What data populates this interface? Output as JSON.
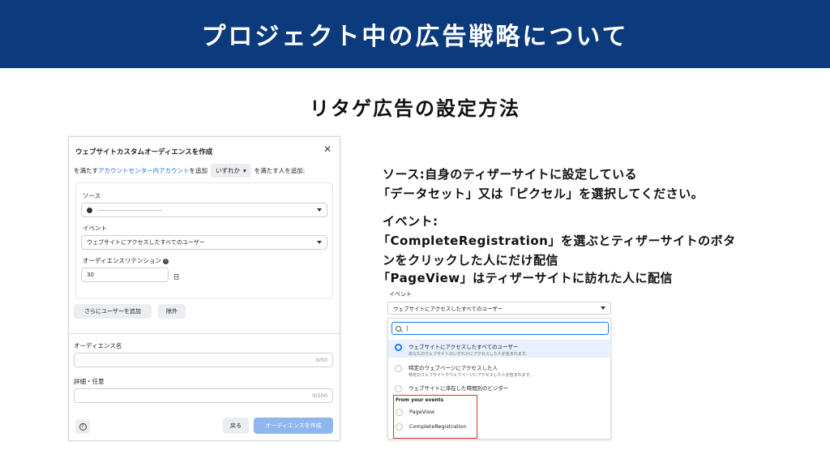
{
  "header": {
    "title": "プロジェクト中の広告戦略について"
  },
  "subtitle": "リタゲ広告の設定方法",
  "dialog": {
    "title": "ウェブサイトカスタムオーディエンスを作成",
    "criteria_prefix": "を満たす",
    "criteria_link": "アカウントセンター内アカウント",
    "criteria_mid": "を追加",
    "criteria_pill": "いずれか",
    "criteria_suffix": "を満たす人を追加:",
    "source_label": "ソース",
    "event_label": "イベント",
    "event_value": "ウェブサイトにアクセスしたすべてのユーザー",
    "retention_label": "オーディエンスリテンション",
    "retention_value": "30",
    "retention_unit": "日",
    "add_users_button": "さらにユーザーを追加",
    "exclude_button": "除外",
    "name_label": "オーディエンス名",
    "name_counter": "0/50",
    "detail_label": "詳細・任意",
    "detail_counter": "0/100",
    "back_button": "戻る",
    "create_button": "オーディエンスを作成"
  },
  "description": {
    "line1": "ソース:自身のティザーサイトに設定している",
    "line2": "「データセット」又は「ピクセル」を選択してください。",
    "line3": "イベント:",
    "line4": "「CompleteRegistration」を選ぶとティザーサイトのボタ",
    "line5": "ンをクリックした人にだけ配信",
    "line6": "「PageView」はティザーサイトに訪れた人に配信"
  },
  "event_dropdown": {
    "label": "イベント",
    "selected": "ウェブサイトにアクセスしたすべてのユーザー",
    "search_value": "|",
    "options": [
      {
        "main": "ウェブサイトにアクセスしたすべてのユーザー",
        "sub": "あなたのウェブサイトのいずれかにアクセスした人が含まれます。"
      },
      {
        "main": "特定のウェブページにアクセスした人",
        "sub": "特定のウェブサイトやウェブページにアクセスした人が含まれます。"
      },
      {
        "main": "ウェブサイトに滞在した時間別のビジター",
        "sub": ""
      }
    ],
    "events_heading": "From your events",
    "events": [
      "PageView",
      "CompleteRegistration"
    ]
  },
  "colors": {
    "header_bg": "#0b3a7d",
    "link": "#216fdb",
    "primary_button": "#8fb7ef",
    "highlight_box": "#e0302c"
  }
}
